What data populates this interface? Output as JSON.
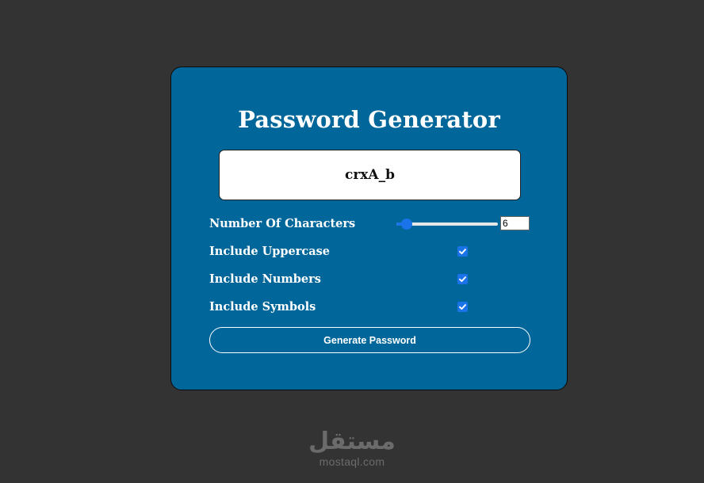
{
  "app": {
    "title": "Password Generator",
    "password": "crxA_b"
  },
  "options": {
    "length_label": "Number Of Characters",
    "length_value": "6",
    "length_slider_fraction": 0.1,
    "uppercase_label": "Include Uppercase",
    "uppercase_checked": true,
    "numbers_label": "Include Numbers",
    "numbers_checked": true,
    "symbols_label": "Include Symbols",
    "symbols_checked": true
  },
  "actions": {
    "generate_label": "Generate Password"
  },
  "watermark": {
    "arabic": "مستقل",
    "latin": "mostaql.com"
  },
  "colors": {
    "page_background": "#333333",
    "card_background": "#016699",
    "accent": "#1a73e8"
  },
  "icons": {
    "checkbox": "checkmark-icon"
  }
}
